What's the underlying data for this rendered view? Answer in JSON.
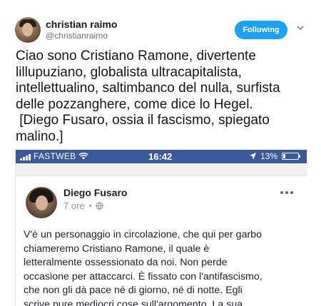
{
  "tweet": {
    "author": {
      "display_name": "christian raimo",
      "handle": "@christianraimo"
    },
    "follow_button_label": "Following",
    "text_lines": [
      "Ciao sono Cristiano Ramone, divertente",
      "lillupuziano, globalista ultracapitalista,",
      "intellettualino, saltimbanco  del nulla, surfista",
      "delle pozzanghere, come dice lo Hegel.",
      " [Diego Fusaro, ossia il fascismo, spiegato",
      "malino.]"
    ]
  },
  "embedded_screenshot": {
    "status_bar": {
      "carrier": "FASTWEB",
      "time": "16:42",
      "battery": "13%",
      "battery_level": 0.13
    },
    "post": {
      "author_name": "Diego Fusaro",
      "time_ago": "7 ore",
      "text_lines": [
        "V'è un personaggio in circolazione, che qui per garbo",
        "chiameremo Cristiano Ramone, il quale è",
        "letteralmente ossessionato da noi. Non perde",
        "occasione per attaccarci. È fissato con l'antifascismo,",
        "che non gli dà pace né di giorno, né di notte. Egli",
        "scrive pure mediocri cose sull'argomento. La sua"
      ]
    }
  },
  "colors": {
    "twitter_blue": "#1da1f2",
    "facebook_blue": "#3b5998",
    "text_dark": "#14171a",
    "text_muted": "#657786"
  },
  "icons": [
    "chevron-down-icon",
    "signal-icon",
    "wifi-icon",
    "location-icon",
    "battery-icon",
    "globe-icon",
    "more-options-icon"
  ]
}
